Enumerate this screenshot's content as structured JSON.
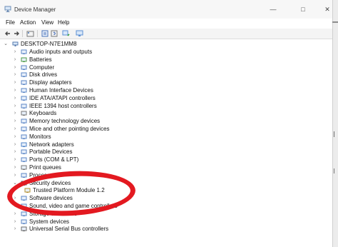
{
  "window": {
    "title": "Device Manager"
  },
  "menu": [
    "File",
    "Action",
    "View",
    "Help"
  ],
  "tree": {
    "root": "DESKTOP-N7E1MM8",
    "items": [
      {
        "label": "Audio inputs and outputs",
        "expander": "›",
        "icon": "speaker-icon"
      },
      {
        "label": "Batteries",
        "expander": "›",
        "icon": "battery-icon"
      },
      {
        "label": "Computer",
        "expander": "›",
        "icon": "monitor-icon"
      },
      {
        "label": "Disk drives",
        "expander": "›",
        "icon": "disk-icon"
      },
      {
        "label": "Display adapters",
        "expander": "›",
        "icon": "display-adapter-icon"
      },
      {
        "label": "Human Interface Devices",
        "expander": "›",
        "icon": "hid-icon"
      },
      {
        "label": "IDE ATA/ATAPI controllers",
        "expander": "›",
        "icon": "ide-icon"
      },
      {
        "label": "IEEE 1394 host controllers",
        "expander": "›",
        "icon": "ieee-icon"
      },
      {
        "label": "Keyboards",
        "expander": "›",
        "icon": "keyboard-icon"
      },
      {
        "label": "Memory technology devices",
        "expander": "›",
        "icon": "memory-icon"
      },
      {
        "label": "Mice and other pointing devices",
        "expander": "›",
        "icon": "mouse-icon"
      },
      {
        "label": "Monitors",
        "expander": "›",
        "icon": "monitor-icon"
      },
      {
        "label": "Network adapters",
        "expander": "›",
        "icon": "network-icon"
      },
      {
        "label": "Portable Devices",
        "expander": "›",
        "icon": "portable-icon"
      },
      {
        "label": "Ports (COM & LPT)",
        "expander": "›",
        "icon": "port-icon"
      },
      {
        "label": "Print queues",
        "expander": "›",
        "icon": "printer-icon"
      },
      {
        "label": "Processors",
        "expander": "›",
        "icon": "processor-icon"
      },
      {
        "label": "Security devices",
        "expander": "⌄",
        "icon": "security-icon"
      },
      {
        "label": "Trusted Platform Module 1.2",
        "expander": "",
        "icon": "tpm-icon",
        "child": true
      },
      {
        "label": "Software devices",
        "expander": "›",
        "icon": "software-icon"
      },
      {
        "label": "Sound, video and game controllers",
        "expander": "›",
        "icon": "sound-icon"
      },
      {
        "label": "Storage controllers",
        "expander": "›",
        "icon": "storage-icon"
      },
      {
        "label": "System devices",
        "expander": "›",
        "icon": "system-icon"
      },
      {
        "label": "Universal Serial Bus controllers",
        "expander": "›",
        "icon": "usb-icon"
      }
    ]
  },
  "colors": {
    "annotation": "#e31920"
  }
}
